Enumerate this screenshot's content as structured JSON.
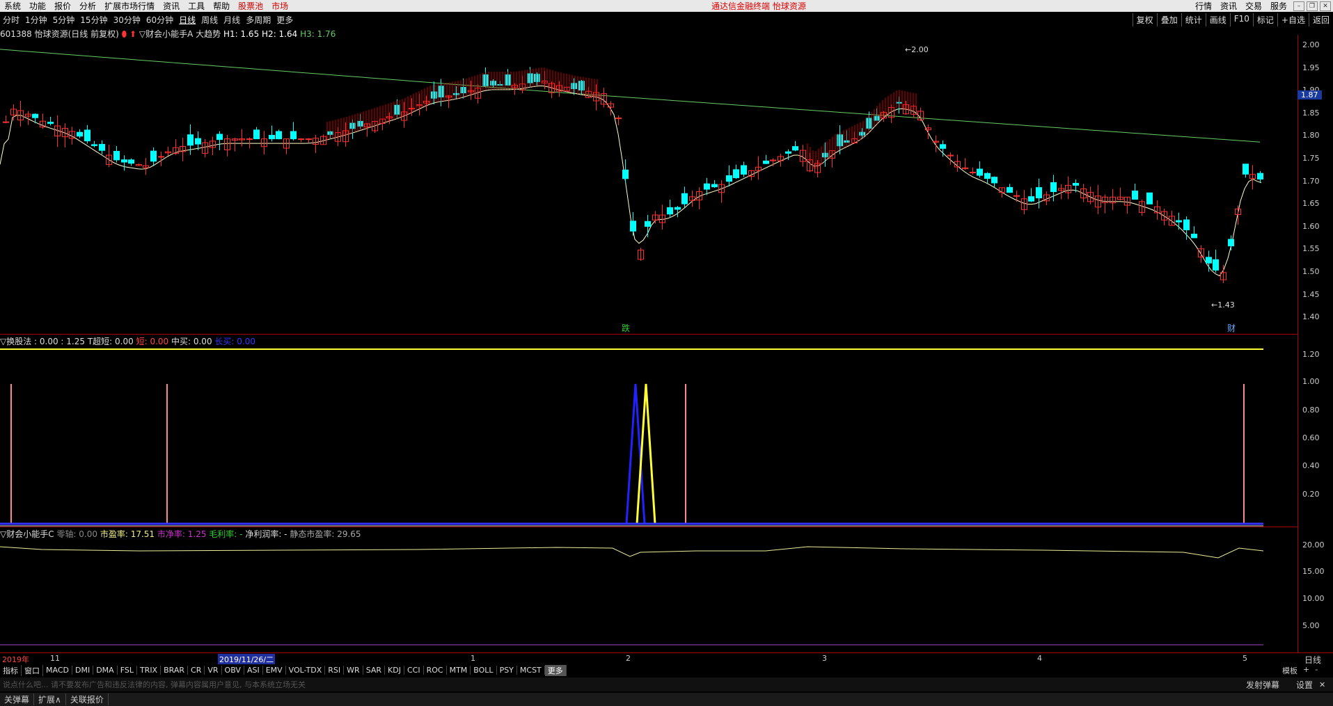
{
  "menu": {
    "items": [
      "系统",
      "功能",
      "报价",
      "分析",
      "扩展市场行情",
      "资讯",
      "工具",
      "帮助"
    ],
    "highlight_items": [
      "股票池",
      "市场"
    ],
    "brand": "通达信金融终端 怡球资源",
    "right_items": [
      "行情",
      "资讯",
      "交易",
      "服务"
    ]
  },
  "periods": {
    "items": [
      "分时",
      "1分钟",
      "5分钟",
      "15分钟",
      "30分钟",
      "60分钟",
      "日线",
      "周线",
      "月线",
      "多周期",
      "更多"
    ],
    "active": "日线",
    "tools": [
      "复权",
      "叠加",
      "统计",
      "画线",
      "F10",
      "标记",
      "+自选",
      "返回"
    ]
  },
  "main_panel": {
    "title_stock": "601388 怡球资源(日线 前复权)",
    "title_indicator": "▽财会小能手A 大趋势",
    "h1": "H1: 1.65",
    "h2": "H2: 1.64",
    "h3": "H3: 1.76",
    "price_high_label": "2.00",
    "price_low_label": "1.43",
    "current_price": "1.87",
    "marker_a": "跌",
    "marker_b": "财",
    "ticks": [
      "2.00",
      "1.95",
      "1.90",
      "1.85",
      "1.80",
      "1.75",
      "1.70",
      "1.65",
      "1.60",
      "1.55",
      "1.50",
      "1.45",
      "1.40"
    ]
  },
  "panel2": {
    "title": "▽换股法 : 0.00 : 1.25",
    "t1": "T超短: 0.00",
    "t2": "短: 0.00",
    "t3": "中买: 0.00",
    "t4": "长买: 0.00",
    "ticks": [
      "1.20",
      "1.00",
      "0.80",
      "0.60",
      "0.40",
      "0.20"
    ]
  },
  "panel3": {
    "title": "▽财会小能手C",
    "zero_axis": "零轴: 0.00",
    "pe": "市盈率: 17.51",
    "pb": "市净率: 1.25",
    "gross_margin": "毛利率: -",
    "net_margin": "净利润率: -",
    "static_pe": "静态市盈率: 29.65",
    "ticks": [
      "20.00",
      "15.00",
      "10.00",
      "5.00"
    ]
  },
  "dates": {
    "labels": [
      "2019年",
      "11",
      "2019/11/26/二",
      "1",
      "2",
      "3",
      "4",
      "5"
    ],
    "right_label": "日线"
  },
  "tabs": {
    "items": [
      "指标",
      "窗口",
      "MACD",
      "DMI",
      "DMA",
      "FSL",
      "TRIX",
      "BRAR",
      "CR",
      "VR",
      "OBV",
      "ASI",
      "EMV",
      "VOL-TDX",
      "RSI",
      "WR",
      "SAR",
      "KDJ",
      "CCI",
      "ROC",
      "MTM",
      "BOLL",
      "PSY",
      "MCST",
      "更多"
    ],
    "right": [
      "模板",
      "+",
      "-"
    ]
  },
  "marquee": {
    "text": "说点什么吧...   请不要发布广告和违反法律的内容, 弹幕内容属用户意见, 与本系统立场无关",
    "send_label": "发射弹幕",
    "settings_label": "设置"
  },
  "bottom": {
    "items": [
      "关弹幕",
      "扩展∧",
      "关联报价"
    ]
  },
  "colors": {
    "up": "#ff3030",
    "down": "#00ffff",
    "ma_short": "#ffffcc",
    "ma_long": "#66cc66",
    "axis": "#aa0000"
  },
  "chart_data": {
    "type": "candlestick",
    "period": "日线",
    "price_range": [
      1.38,
      2.02
    ],
    "highest": 2.0,
    "lowest": 1.43
  }
}
